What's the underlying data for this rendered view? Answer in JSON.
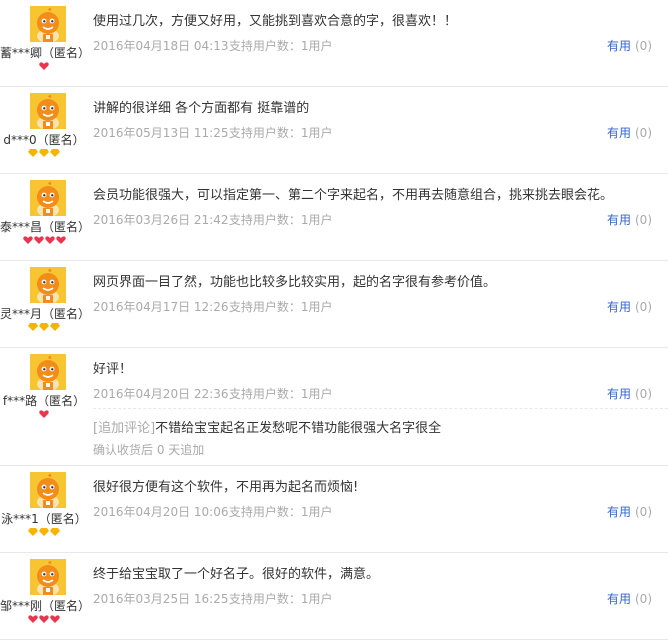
{
  "reviews": [
    {
      "username": "蓄***卿（匿名）",
      "badge_type": "red",
      "badge_count": 1,
      "text": "使用过几次，方便又好用，又能挑到喜欢合意的字，很喜欢！！",
      "date": "2016年04月18日 04:13",
      "support": "支持用户数：1用户",
      "useful_label": "有用",
      "useful_count": "(0)"
    },
    {
      "username": "d***0（匿名）",
      "badge_type": "gold",
      "badge_count": 3,
      "text": "讲解的很详细 各个方面都有 挺靠谱的",
      "date": "2016年05月13日 11:25",
      "support": "支持用户数：1用户",
      "useful_label": "有用",
      "useful_count": "(0)"
    },
    {
      "username": "泰***昌（匿名）",
      "badge_type": "red",
      "badge_count": 4,
      "text": "会员功能很强大，可以指定第一、第二个字来起名，不用再去随意组合，挑来挑去眼会花。",
      "date": "2016年03月26日 21:42",
      "support": "支持用户数：1用户",
      "useful_label": "有用",
      "useful_count": "(0)"
    },
    {
      "username": "灵***月（匿名）",
      "badge_type": "gold",
      "badge_count": 3,
      "text": "网页界面一目了然，功能也比较多比较实用，起的名字很有参考价值。",
      "date": "2016年04月17日 12:26",
      "support": "支持用户数：1用户",
      "useful_label": "有用",
      "useful_count": "(0)"
    },
    {
      "username": "f***路（匿名）",
      "badge_type": "red",
      "badge_count": 1,
      "text": "好评！",
      "date": "2016年04月20日 22:36",
      "support": "支持用户数：1用户",
      "useful_label": "有用",
      "useful_count": "(0)",
      "append": {
        "tag": "[追加评论]",
        "text": "不错给宝宝起名正发愁呢不错功能很强大名字很全",
        "meta": "确认收货后 0 天追加"
      }
    },
    {
      "username": "泳***1（匿名）",
      "badge_type": "gold",
      "badge_count": 3,
      "text": "很好很方便有这个软件，不用再为起名而烦恼!",
      "date": "2016年04月20日 10:06",
      "support": "支持用户数：1用户",
      "useful_label": "有用",
      "useful_count": "(0)"
    },
    {
      "username": "邹***刚（匿名）",
      "badge_type": "red",
      "badge_count": 3,
      "text": "终于给宝宝取了一个好名子。很好的软件，满意。",
      "date": "2016年03月25日 16:25",
      "support": "支持用户数：1用户",
      "useful_label": "有用",
      "useful_count": "(0)"
    }
  ],
  "icons": {
    "avatar": "default-avatar-icon",
    "gold_badge": "gold-diamond-icon",
    "red_badge": "red-heart-icon"
  },
  "colors": {
    "avatar_bg": "#f7c531",
    "avatar_face": "#f28c1b",
    "useful_link": "#3366cc",
    "meta_text": "#aaaaaa",
    "gold_badge": "#f4b400",
    "red_badge": "#e8364f"
  }
}
